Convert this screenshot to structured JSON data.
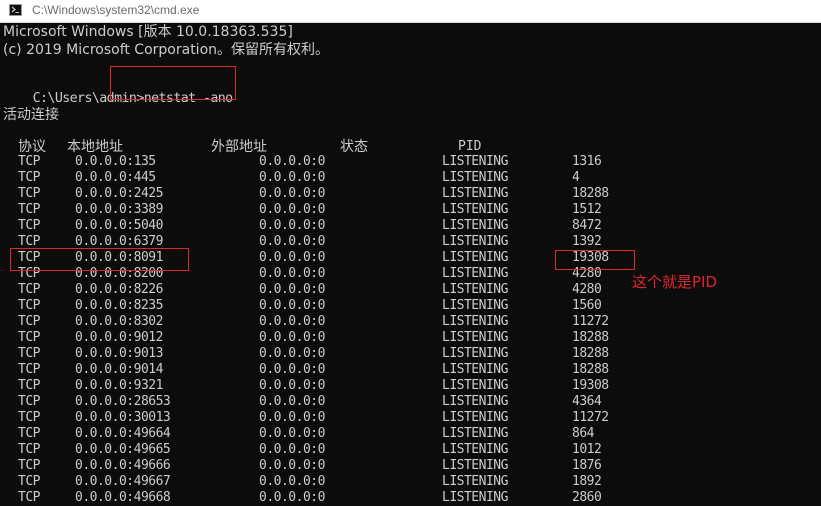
{
  "window": {
    "title": "C:\\Windows\\system32\\cmd.exe",
    "icon": "console-icon"
  },
  "console": {
    "banner_line1": "Microsoft Windows [版本 10.0.18363.535]",
    "banner_line2": "(c) 2019 Microsoft Corporation。保留所有权利。",
    "prompt": "C:\\Users\\admin",
    "command": ">netstat -ano",
    "section_title": "活动连接",
    "headers": {
      "proto": "协议",
      "local": "本地地址",
      "foreign": "外部地址",
      "state": "状态",
      "pid": "PID"
    },
    "rows": [
      {
        "proto": "TCP",
        "local": "0.0.0.0:135",
        "foreign": "0.0.0.0:0",
        "state": "LISTENING",
        "pid": "1316"
      },
      {
        "proto": "TCP",
        "local": "0.0.0.0:445",
        "foreign": "0.0.0.0:0",
        "state": "LISTENING",
        "pid": "4"
      },
      {
        "proto": "TCP",
        "local": "0.0.0.0:2425",
        "foreign": "0.0.0.0:0",
        "state": "LISTENING",
        "pid": "18288"
      },
      {
        "proto": "TCP",
        "local": "0.0.0.0:3389",
        "foreign": "0.0.0.0:0",
        "state": "LISTENING",
        "pid": "1512"
      },
      {
        "proto": "TCP",
        "local": "0.0.0.0:5040",
        "foreign": "0.0.0.0:0",
        "state": "LISTENING",
        "pid": "8472"
      },
      {
        "proto": "TCP",
        "local": "0.0.0.0:6379",
        "foreign": "0.0.0.0:0",
        "state": "LISTENING",
        "pid": "1392"
      },
      {
        "proto": "TCP",
        "local": "0.0.0.0:8091",
        "foreign": "0.0.0.0:0",
        "state": "LISTENING",
        "pid": "19308"
      },
      {
        "proto": "TCP",
        "local": "0.0.0.0:8200",
        "foreign": "0.0.0.0:0",
        "state": "LISTENING",
        "pid": "4280"
      },
      {
        "proto": "TCP",
        "local": "0.0.0.0:8226",
        "foreign": "0.0.0.0:0",
        "state": "LISTENING",
        "pid": "4280"
      },
      {
        "proto": "TCP",
        "local": "0.0.0.0:8235",
        "foreign": "0.0.0.0:0",
        "state": "LISTENING",
        "pid": "1560"
      },
      {
        "proto": "TCP",
        "local": "0.0.0.0:8302",
        "foreign": "0.0.0.0:0",
        "state": "LISTENING",
        "pid": "11272"
      },
      {
        "proto": "TCP",
        "local": "0.0.0.0:9012",
        "foreign": "0.0.0.0:0",
        "state": "LISTENING",
        "pid": "18288"
      },
      {
        "proto": "TCP",
        "local": "0.0.0.0:9013",
        "foreign": "0.0.0.0:0",
        "state": "LISTENING",
        "pid": "18288"
      },
      {
        "proto": "TCP",
        "local": "0.0.0.0:9014",
        "foreign": "0.0.0.0:0",
        "state": "LISTENING",
        "pid": "18288"
      },
      {
        "proto": "TCP",
        "local": "0.0.0.0:9321",
        "foreign": "0.0.0.0:0",
        "state": "LISTENING",
        "pid": "19308"
      },
      {
        "proto": "TCP",
        "local": "0.0.0.0:28653",
        "foreign": "0.0.0.0:0",
        "state": "LISTENING",
        "pid": "4364"
      },
      {
        "proto": "TCP",
        "local": "0.0.0.0:30013",
        "foreign": "0.0.0.0:0",
        "state": "LISTENING",
        "pid": "11272"
      },
      {
        "proto": "TCP",
        "local": "0.0.0.0:49664",
        "foreign": "0.0.0.0:0",
        "state": "LISTENING",
        "pid": "864"
      },
      {
        "proto": "TCP",
        "local": "0.0.0.0:49665",
        "foreign": "0.0.0.0:0",
        "state": "LISTENING",
        "pid": "1012"
      },
      {
        "proto": "TCP",
        "local": "0.0.0.0:49666",
        "foreign": "0.0.0.0:0",
        "state": "LISTENING",
        "pid": "1876"
      },
      {
        "proto": "TCP",
        "local": "0.0.0.0:49667",
        "foreign": "0.0.0.0:0",
        "state": "LISTENING",
        "pid": "1892"
      },
      {
        "proto": "TCP",
        "local": "0.0.0.0:49668",
        "foreign": "0.0.0.0:0",
        "state": "LISTENING",
        "pid": "2860"
      }
    ]
  },
  "annotation": {
    "text": "这个就是PID",
    "color": "#e0262c"
  },
  "colors": {
    "console_bg": "#0c0c0c",
    "console_text": "#cccccc",
    "highlight": "#e0262c"
  }
}
